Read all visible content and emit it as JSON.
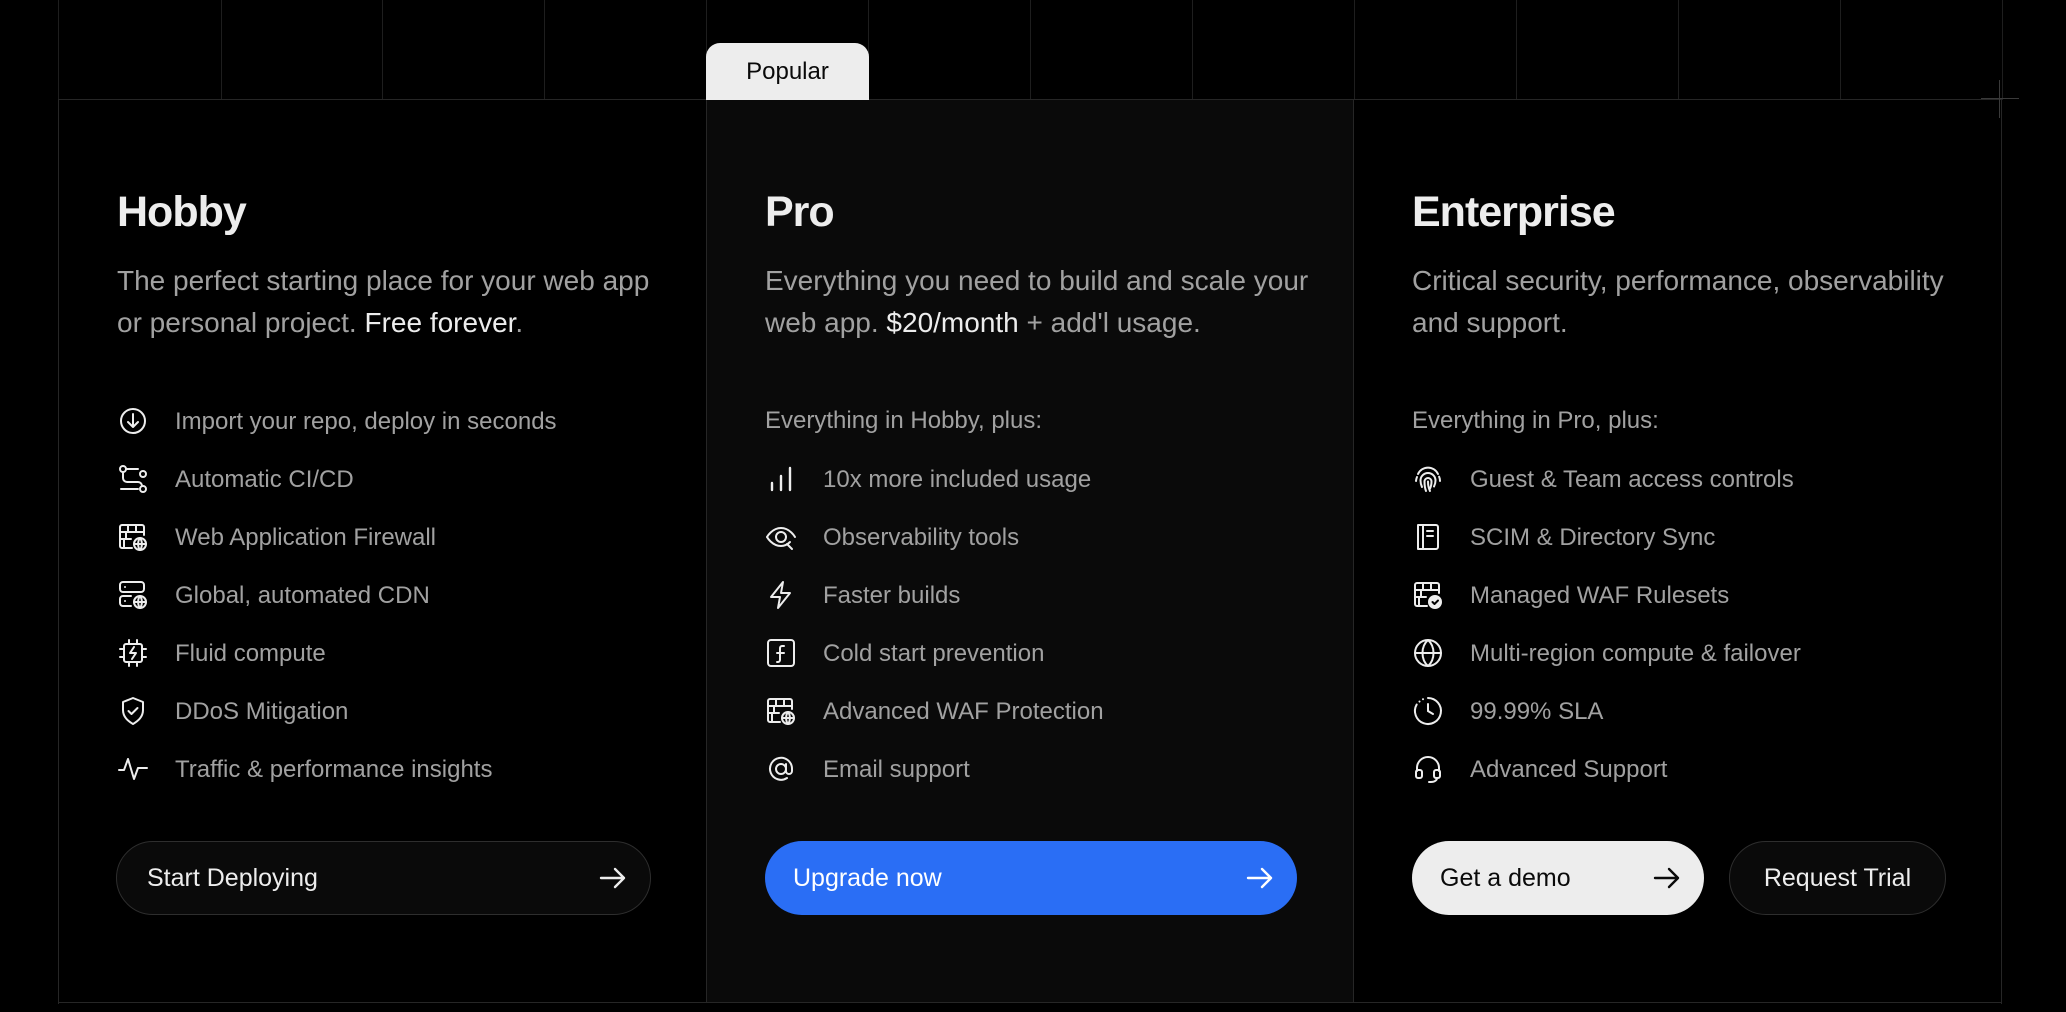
{
  "badge": "Popular",
  "hobby": {
    "name": "Hobby",
    "desc_text": "The perfect starting place for your web app or personal project. ",
    "desc_highlight": "Free forever",
    "desc_tail": ".",
    "features": [
      {
        "icon": "arrow-down-circle-icon",
        "label": "Import your repo, deploy in seconds"
      },
      {
        "icon": "git-merge-icon",
        "label": "Automatic CI/CD"
      },
      {
        "icon": "firewall-globe-icon",
        "label": "Web Application Firewall"
      },
      {
        "icon": "server-globe-icon",
        "label": "Global, automated CDN"
      },
      {
        "icon": "cpu-chip-icon",
        "label": "Fluid compute"
      },
      {
        "icon": "shield-check-icon",
        "label": "DDoS Mitigation"
      },
      {
        "icon": "activity-pulse-icon",
        "label": "Traffic & performance insights"
      }
    ],
    "cta": "Start Deploying"
  },
  "pro": {
    "name": "Pro",
    "desc_text": "Everything you need to build and scale your web app. ",
    "desc_highlight": "$20/month",
    "desc_tail": " + add'l usage.",
    "plus": "Everything in Hobby, plus:",
    "features": [
      {
        "icon": "bar-chart-icon",
        "label": "10x more included usage"
      },
      {
        "icon": "eye-icon",
        "label": "Observability tools"
      },
      {
        "icon": "lightning-bolt-icon",
        "label": "Faster builds"
      },
      {
        "icon": "function-icon",
        "label": "Cold start prevention"
      },
      {
        "icon": "firewall-globe-icon",
        "label": "Advanced WAF Protection"
      },
      {
        "icon": "at-sign-icon",
        "label": "Email support"
      }
    ],
    "cta": "Upgrade now"
  },
  "enterprise": {
    "name": "Enterprise",
    "desc_text": "Critical security, performance, observability and support.",
    "plus": "Everything in Pro, plus:",
    "features": [
      {
        "icon": "fingerprint-icon",
        "label": "Guest & Team access controls"
      },
      {
        "icon": "directory-book-icon",
        "label": "SCIM & Directory Sync"
      },
      {
        "icon": "firewall-check-icon",
        "label": "Managed WAF Rulesets"
      },
      {
        "icon": "globe-icon",
        "label": "Multi-region compute & failover"
      },
      {
        "icon": "clock-dashed-icon",
        "label": "99.99% SLA"
      },
      {
        "icon": "headset-icon",
        "label": "Advanced Support"
      }
    ],
    "cta_primary": "Get a demo",
    "cta_secondary": "Request Trial"
  },
  "colors": {
    "background": "#000000",
    "pro_background": "#0a0a0a",
    "primary_button": "#2a6ef5",
    "badge": "#ededed",
    "muted_text": "#a1a1a1"
  }
}
